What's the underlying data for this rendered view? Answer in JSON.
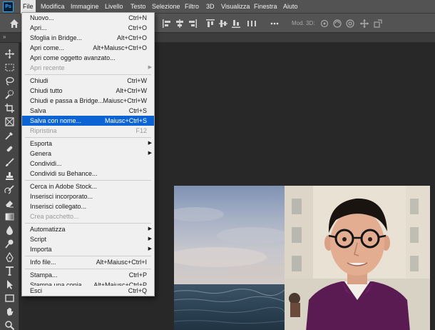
{
  "app": {
    "logo_text": "Ps"
  },
  "menubar": {
    "items": [
      "File",
      "Modifica",
      "Immagine",
      "Livello",
      "Testo",
      "Selezione",
      "Filtro",
      "3D",
      "Visualizza",
      "Finestra",
      "Aiuto"
    ],
    "active": "File"
  },
  "options_bar": {
    "mod3d_label": "Mod. 3D:"
  },
  "panel_strip": {
    "collapse_glyph": "»"
  },
  "file_menu": {
    "items": [
      {
        "label": "Nuovo...",
        "shortcut": "Ctrl+N"
      },
      {
        "label": "Apri...",
        "shortcut": "Ctrl+O"
      },
      {
        "label": "Sfoglia in Bridge...",
        "shortcut": "Alt+Ctrl+O"
      },
      {
        "label": "Apri come...",
        "shortcut": "Alt+Maiusc+Ctrl+O"
      },
      {
        "label": "Apri come oggetto avanzato...",
        "shortcut": ""
      },
      {
        "label": "Apri recente",
        "shortcut": "",
        "submenu": true,
        "disabled": true
      },
      {
        "label": "Chiudi",
        "shortcut": "Ctrl+W"
      },
      {
        "label": "Chiudi tutto",
        "shortcut": "Alt+Ctrl+W"
      },
      {
        "label": "Chiudi e passa a Bridge...",
        "shortcut": "Maiusc+Ctrl+W"
      },
      {
        "label": "Salva",
        "shortcut": "Ctrl+S"
      },
      {
        "label": "Salva con nome...",
        "shortcut": "Maiusc+Ctrl+S",
        "highlighted": true
      },
      {
        "label": "Ripristina",
        "shortcut": "F12",
        "disabled": true
      },
      {
        "label": "Esporta",
        "shortcut": "",
        "submenu": true
      },
      {
        "label": "Genera",
        "shortcut": "",
        "submenu": true
      },
      {
        "label": "Condividi...",
        "shortcut": ""
      },
      {
        "label": "Condividi su Behance...",
        "shortcut": ""
      },
      {
        "label": "Cerca in Adobe Stock...",
        "shortcut": ""
      },
      {
        "label": "Inserisci incorporato...",
        "shortcut": ""
      },
      {
        "label": "Inserisci collegato...",
        "shortcut": ""
      },
      {
        "label": "Crea pacchetto...",
        "shortcut": "",
        "disabled": true
      },
      {
        "label": "Automatizza",
        "shortcut": "",
        "submenu": true
      },
      {
        "label": "Script",
        "shortcut": "",
        "submenu": true
      },
      {
        "label": "Importa",
        "shortcut": "",
        "submenu": true
      },
      {
        "label": "Info file...",
        "shortcut": "Alt+Maiusc+Ctrl+I"
      },
      {
        "label": "Stampa...",
        "shortcut": "Ctrl+P"
      },
      {
        "label": "Stampa una copia",
        "shortcut": "Alt+Maiusc+Ctrl+P"
      },
      {
        "label": "Esci",
        "shortcut": "Ctrl+Q"
      }
    ]
  },
  "colors": {
    "menu_highlight": "#0b63d4",
    "ui_dark": "#535353",
    "canvas_bg": "#282828",
    "shirt_purple": "#5a1a52"
  }
}
